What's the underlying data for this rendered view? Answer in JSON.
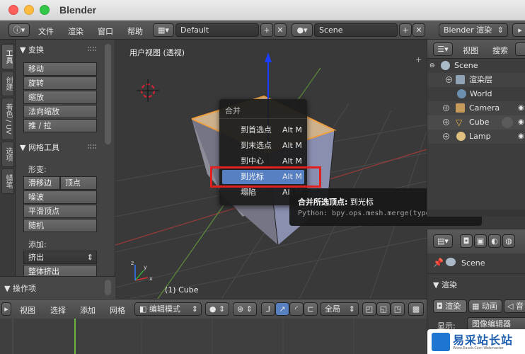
{
  "window": {
    "title": "Blender"
  },
  "header": {
    "menus": [
      "文件",
      "渲染",
      "窗口",
      "帮助"
    ],
    "layout_value": "Default",
    "scene_value": "Scene",
    "engine_value": "Blender 渲染"
  },
  "toolshelf": {
    "tabs": [
      "工具",
      "创建",
      "着色 / UV",
      "选项",
      "蜡笔"
    ],
    "transform_title": "变换",
    "transform_buttons": [
      "移动",
      "旋转",
      "缩放",
      "法向缩放",
      "推 / 拉"
    ],
    "mesh_tools_title": "网格工具",
    "deform_label": "形变:",
    "slide_edge": "滑移边",
    "vertex": "顶点",
    "noise": "噪波",
    "smooth_vertex": "平滑顶点",
    "random": "随机",
    "add_label": "添加:",
    "extrude_value": "挤出",
    "extrude_region": "整体挤出",
    "operator_title": "操作项"
  },
  "viewport": {
    "title": "用户视图 (透视)",
    "object_label": "(1) Cube"
  },
  "merge_menu": {
    "title": "合并",
    "items": [
      {
        "label": "到首选点",
        "shortcut": "Alt M"
      },
      {
        "label": "到末选点",
        "shortcut": "Alt M"
      },
      {
        "label": "到中心",
        "shortcut": "Alt M"
      },
      {
        "label": "到光标",
        "shortcut": "Alt M"
      },
      {
        "label": "塌陷",
        "shortcut": "Alt M"
      }
    ],
    "highlighted_index": 3
  },
  "tooltip": {
    "title": "合并所选顶点:",
    "value": "到光标",
    "python": "Python: bpy.ops.mesh.merge(type='CURSOR')"
  },
  "outliner": {
    "menus": [
      "视图",
      "搜索"
    ],
    "items": [
      {
        "label": "Scene",
        "icon": "scene-icon"
      },
      {
        "label": "渲染层",
        "icon": "render-layer-icon"
      },
      {
        "label": "World",
        "icon": "world-icon"
      },
      {
        "label": "Camera",
        "icon": "camera-icon"
      },
      {
        "label": "Cube",
        "icon": "mesh-icon"
      },
      {
        "label": "Lamp",
        "icon": "lamp-icon"
      }
    ]
  },
  "properties": {
    "scene_label": "Scene",
    "render_title": "渲染",
    "tabs": [
      "渲染",
      "动画",
      "音"
    ],
    "display_label": "显示:",
    "display_value": "图像编辑器"
  },
  "bottombar": {
    "menus": [
      "视图",
      "选择",
      "添加",
      "网格"
    ],
    "mode_value": "编辑模式",
    "pivot_value": "全局"
  },
  "watermark": {
    "text": "易采站长站",
    "sub": "Www.Easck.Com Webmaster"
  },
  "colors": {
    "accent": "#5680c2",
    "highlight_box": "#e21f1f",
    "selected_edge": "#f0a040"
  }
}
